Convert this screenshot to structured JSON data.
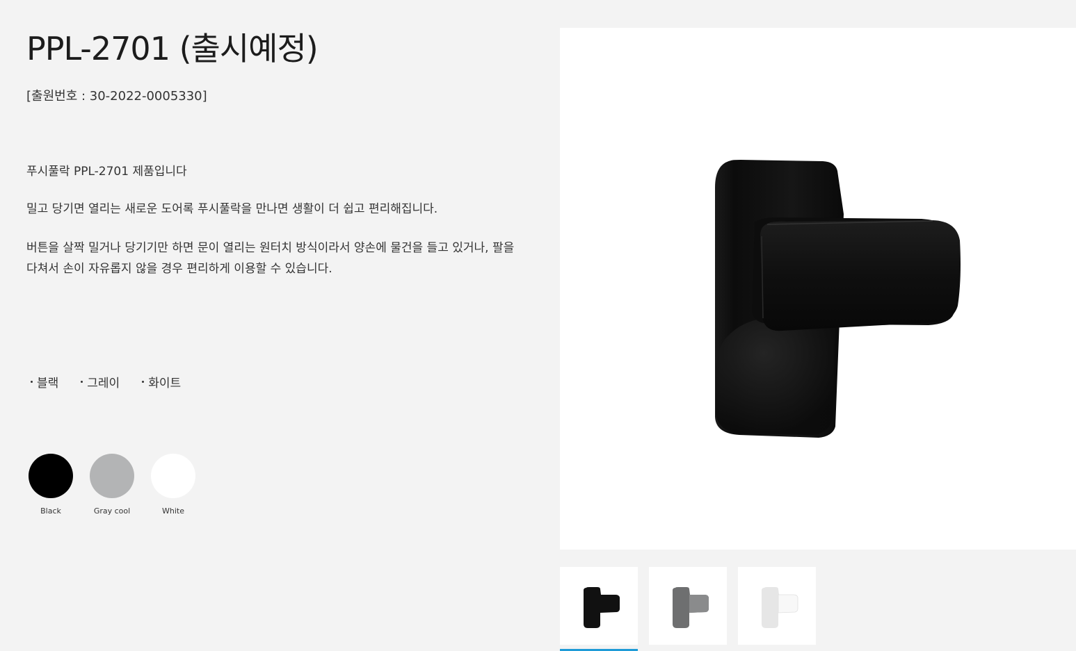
{
  "product": {
    "title": "PPL-2701 (출시예정)",
    "application_number": "[출원번호 : 30-2022-0005330]",
    "description_title": "푸시풀락 PPL-2701 제품입니다",
    "description_p1": "밀고 당기면 열리는 새로운 도어록 푸시풀락을 만나면 생활이 더 쉽고 편리해집니다.",
    "description_p2": "버튼을 살짝 밀거나 당기기만 하면 문이 열리는 원터치 방식이라서 양손에 물건을 들고 있거나, 팔을 다쳐서 손이 자유롭지 않을 경우 편리하게 이용할 수 있습니다."
  },
  "color_names": [
    {
      "label": "블랙"
    },
    {
      "label": "그레이"
    },
    {
      "label": "화이트"
    }
  ],
  "swatches": [
    {
      "label": "Black",
      "color": "#000000"
    },
    {
      "label": "Gray cool",
      "color": "#b3b4b5"
    },
    {
      "label": "White",
      "color": "#ffffff"
    }
  ],
  "thumbnails": [
    {
      "name": "black",
      "color": "#111111",
      "active": true
    },
    {
      "name": "gray",
      "color": "#6e6f70",
      "active": false
    },
    {
      "name": "white",
      "color": "#f4f4f4",
      "active": false
    }
  ]
}
